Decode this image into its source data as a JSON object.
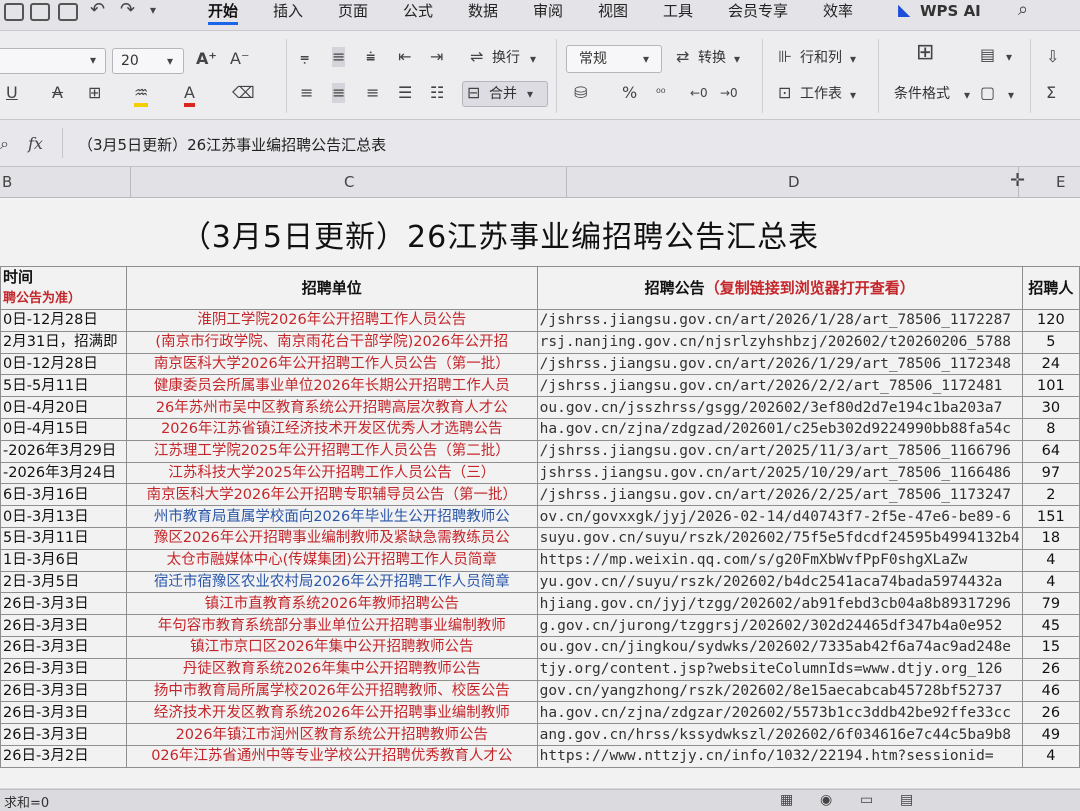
{
  "menu": {
    "tabs": [
      "开始",
      "插入",
      "页面",
      "公式",
      "数据",
      "审阅",
      "视图",
      "工具",
      "会员专享",
      "效率"
    ],
    "wps_ai": "WPS AI"
  },
  "ribbon": {
    "font_size": "20",
    "wrap": "换行",
    "number_format": "常规",
    "convert": "转换",
    "rows_cols": "行和列",
    "merge": "合并",
    "worksheet": "工作表",
    "cond_format": "条件格式"
  },
  "formula_bar": {
    "fx": "fx",
    "content": "（3月5日更新）26江苏事业编招聘公告汇总表"
  },
  "columns": [
    "B",
    "C",
    "D",
    "E"
  ],
  "sheet": {
    "title": "（3月5日更新）26江苏事业编招聘公告汇总表",
    "header": {
      "time": "时间",
      "time_note": "聘公告为准）",
      "unit": "招聘单位",
      "notice": "招聘公告",
      "notice_note": "（复制链接到浏览器打开查看）",
      "count": "招聘人"
    },
    "rows": [
      {
        "time": "0日-12月28日",
        "unit": "淮阴工学院2026年公开招聘工作人员公告",
        "link": "/jshrss.jiangsu.gov.cn/art/2026/1/28/art_78506_1172287",
        "num": "120",
        "blue": false
      },
      {
        "time": "2月31日，招满即",
        "unit": "(南京市行政学院、南京雨花台干部学院)2026年公开招",
        "link": "rsj.nanjing.gov.cn/njsrlzyhshbzj/202602/t20260206_5788",
        "num": "5",
        "blue": false
      },
      {
        "time": "0日-12月28日",
        "unit": "南京医科大学2026年公开招聘工作人员公告（第一批）",
        "link": "/jshrss.jiangsu.gov.cn/art/2026/1/29/art_78506_1172348",
        "num": "24",
        "blue": false
      },
      {
        "time": "5日-5月11日",
        "unit": "健康委员会所属事业单位2026年长期公开招聘工作人员",
        "link": "/jshrss.jiangsu.gov.cn/art/2026/2/2/art_78506_1172481",
        "num": "101",
        "blue": false
      },
      {
        "time": "0日-4月20日",
        "unit": "26年苏州市吴中区教育系统公开招聘高层次教育人才公",
        "link": "ou.gov.cn/jsszhrss/gsgg/202602/3ef80d2d7e194c1ba203a7",
        "num": "30",
        "blue": false
      },
      {
        "time": "0日-4月15日",
        "unit": "2026年江苏省镇江经济技术开发区优秀人才选聘公告",
        "link": "ha.gov.cn/zjna/zdgzad/202601/c25eb302d9224990bb88fa54c",
        "num": "8",
        "blue": false
      },
      {
        "time": "-2026年3月29日",
        "unit": "江苏理工学院2025年公开招聘工作人员公告（第二批）",
        "link": "/jshrss.jiangsu.gov.cn/art/2025/11/3/art_78506_1166796",
        "num": "64",
        "blue": false
      },
      {
        "time": "-2026年3月24日",
        "unit": "江苏科技大学2025年公开招聘工作人员公告（三）",
        "link": "jshrss.jiangsu.gov.cn/art/2025/10/29/art_78506_1166486",
        "num": "97",
        "blue": false
      },
      {
        "time": "6日-3月16日",
        "unit": "南京医科大学2026年公开招聘专职辅导员公告（第一批）",
        "link": "/jshrss.jiangsu.gov.cn/art/2026/2/25/art_78506_1173247",
        "num": "2",
        "blue": false
      },
      {
        "time": "0日-3月13日",
        "unit": "州市教育局直属学校面向2026年毕业生公开招聘教师公",
        "link": "ov.cn/govxxgk/jyj/2026-02-14/d40743f7-2f5e-47e6-be89-6",
        "num": "151",
        "blue": true
      },
      {
        "time": "5日-3月11日",
        "unit": "豫区2026年公开招聘事业编制教师及紧缺急需教练员公",
        "link": "suyu.gov.cn/suyu/rszk/202602/75f5e5fdcdf24595b4994132b4",
        "num": "18",
        "blue": false
      },
      {
        "time": "1日-3月6日",
        "unit": "太仓市融媒体中心(传媒集团)公开招聘工作人员简章",
        "link": "https://mp.weixin.qq.com/s/g20FmXbWvfPpF0shgXLaZw",
        "num": "4",
        "blue": false
      },
      {
        "time": "2日-3月5日",
        "unit": "宿迁市宿豫区农业农村局2026年公开招聘工作人员简章",
        "link": "yu.gov.cn//suyu/rszk/202602/b4dc2541aca74bada5974432a",
        "num": "4",
        "blue": true
      },
      {
        "time": "26日-3月3日",
        "unit": "镇江市直教育系统2026年教师招聘公告",
        "link": "hjiang.gov.cn/jyj/tzgg/202602/ab91febd3cb04a8b89317296",
        "num": "79",
        "blue": false
      },
      {
        "time": "26日-3月3日",
        "unit": "年句容市教育系统部分事业单位公开招聘事业编制教师",
        "link": "g.gov.cn/jurong/tzggrsj/202602/302d24465df347b4a0e952",
        "num": "45",
        "blue": false
      },
      {
        "time": "26日-3月3日",
        "unit": "镇江市京口区2026年集中公开招聘教师公告",
        "link": "ou.gov.cn/jingkou/sydwks/202602/7335ab42f6a74ac9ad248e",
        "num": "15",
        "blue": false
      },
      {
        "time": "26日-3月3日",
        "unit": "丹徒区教育系统2026年集中公开招聘教师公告",
        "link": "tjy.org/content.jsp?websiteColumnIds=www.dtjy.org_126",
        "num": "26",
        "blue": false
      },
      {
        "time": "26日-3月3日",
        "unit": "扬中市教育局所属学校2026年公开招聘教师、校医公告",
        "link": "gov.cn/yangzhong/rszk/202602/8e15aecabcab45728bf52737",
        "num": "46",
        "blue": false
      },
      {
        "time": "26日-3月3日",
        "unit": "经济技术开发区教育系统2026年公开招聘事业编制教师",
        "link": "ha.gov.cn/zjna/zdgzar/202602/5573b1cc3ddb42be92ffe33cc",
        "num": "26",
        "blue": false
      },
      {
        "time": "26日-3月3日",
        "unit": "2026年镇江市润州区教育系统公开招聘教师公告",
        "link": "ang.gov.cn/hrss/kssydwkszl/202602/6f034616e7c44c5ba9b8",
        "num": "49",
        "blue": false
      },
      {
        "time": "26日-3月2日",
        "unit": "026年江苏省通州中等专业学校公开招聘优秀教育人才公",
        "link": "https://www.nttzjy.cn/info/1032/22194.htm?sessionid=",
        "num": "4",
        "blue": false
      }
    ]
  },
  "status_bar": {
    "text": "求和=0"
  }
}
